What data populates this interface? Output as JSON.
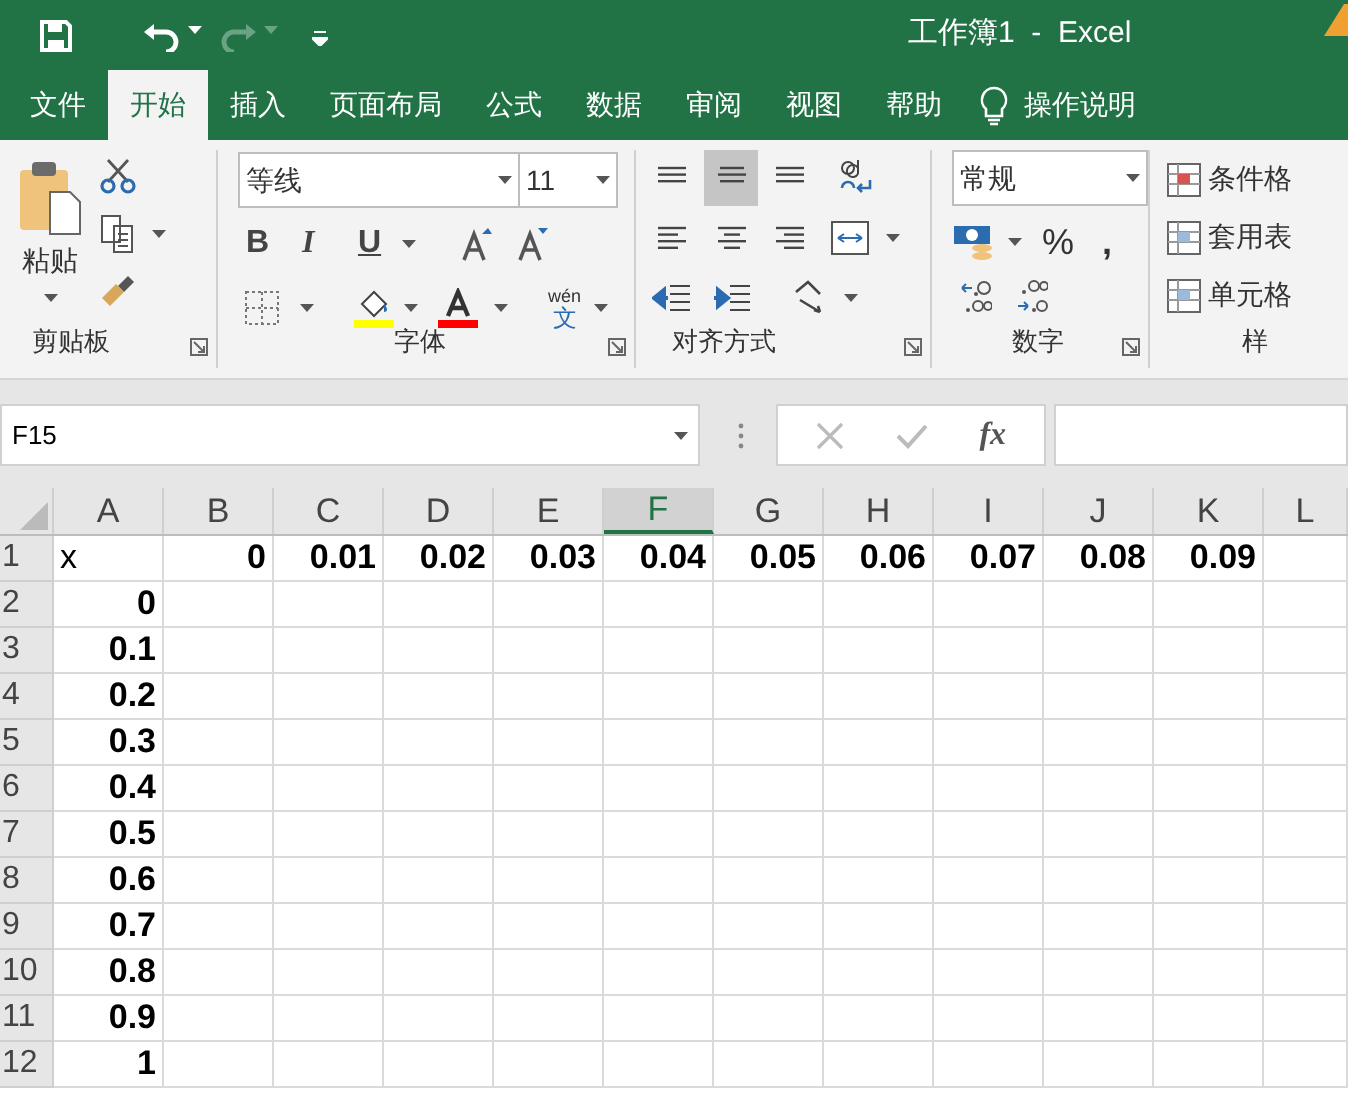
{
  "title_bar": {
    "title": "工作簿1  -  Excel"
  },
  "ribbon_tabs": [
    {
      "label": "文件",
      "selected": false
    },
    {
      "label": "开始",
      "selected": true
    },
    {
      "label": "插入",
      "selected": false
    },
    {
      "label": "页面布局",
      "selected": false
    },
    {
      "label": "公式",
      "selected": false
    },
    {
      "label": "数据",
      "selected": false
    },
    {
      "label": "审阅",
      "selected": false
    },
    {
      "label": "视图",
      "selected": false
    },
    {
      "label": "帮助",
      "selected": false
    }
  ],
  "tell_me": "操作说明",
  "clipboard": {
    "paste": "粘贴",
    "label": "剪贴板"
  },
  "font": {
    "name": "等线",
    "size": "11",
    "bold": "B",
    "italic": "I",
    "underline": "U",
    "phonetic_top": "wén",
    "phonetic_char": "文",
    "label": "字体"
  },
  "alignment": {
    "label": "对齐方式"
  },
  "number": {
    "format": "常规",
    "percent": "%",
    "comma": ",",
    "label": "数字"
  },
  "styles": {
    "items": [
      "条件格",
      "套用表",
      "单元格"
    ],
    "label": "样"
  },
  "formula_bar": {
    "name_box": "F15",
    "fx": "fx"
  },
  "sheet": {
    "columns": [
      {
        "label": "A",
        "selected": false
      },
      {
        "label": "B",
        "selected": false
      },
      {
        "label": "C",
        "selected": false
      },
      {
        "label": "D",
        "selected": false
      },
      {
        "label": "E",
        "selected": false
      },
      {
        "label": "F",
        "selected": true
      },
      {
        "label": "G",
        "selected": false
      },
      {
        "label": "H",
        "selected": false
      },
      {
        "label": "I",
        "selected": false
      },
      {
        "label": "J",
        "selected": false
      },
      {
        "label": "K",
        "selected": false
      },
      {
        "label": "L",
        "selected": false
      }
    ],
    "rows": [
      {
        "label": "1",
        "cells": [
          "x",
          "0",
          "0.01",
          "0.02",
          "0.03",
          "0.04",
          "0.05",
          "0.06",
          "0.07",
          "0.08",
          "0.09",
          ""
        ]
      },
      {
        "label": "2",
        "cells": [
          "0",
          "",
          "",
          "",
          "",
          "",
          "",
          "",
          "",
          "",
          "",
          ""
        ]
      },
      {
        "label": "3",
        "cells": [
          "0.1",
          "",
          "",
          "",
          "",
          "",
          "",
          "",
          "",
          "",
          "",
          ""
        ]
      },
      {
        "label": "4",
        "cells": [
          "0.2",
          "",
          "",
          "",
          "",
          "",
          "",
          "",
          "",
          "",
          "",
          ""
        ]
      },
      {
        "label": "5",
        "cells": [
          "0.3",
          "",
          "",
          "",
          "",
          "",
          "",
          "",
          "",
          "",
          "",
          ""
        ]
      },
      {
        "label": "6",
        "cells": [
          "0.4",
          "",
          "",
          "",
          "",
          "",
          "",
          "",
          "",
          "",
          "",
          ""
        ]
      },
      {
        "label": "7",
        "cells": [
          "0.5",
          "",
          "",
          "",
          "",
          "",
          "",
          "",
          "",
          "",
          "",
          ""
        ]
      },
      {
        "label": "8",
        "cells": [
          "0.6",
          "",
          "",
          "",
          "",
          "",
          "",
          "",
          "",
          "",
          "",
          ""
        ]
      },
      {
        "label": "9",
        "cells": [
          "0.7",
          "",
          "",
          "",
          "",
          "",
          "",
          "",
          "",
          "",
          "",
          ""
        ]
      },
      {
        "label": "10",
        "cells": [
          "0.8",
          "",
          "",
          "",
          "",
          "",
          "",
          "",
          "",
          "",
          "",
          ""
        ]
      },
      {
        "label": "11",
        "cells": [
          "0.9",
          "",
          "",
          "",
          "",
          "",
          "",
          "",
          "",
          "",
          "",
          ""
        ]
      },
      {
        "label": "12",
        "cells": [
          "1",
          "",
          "",
          "",
          "",
          "",
          "",
          "",
          "",
          "",
          "",
          ""
        ]
      }
    ]
  }
}
